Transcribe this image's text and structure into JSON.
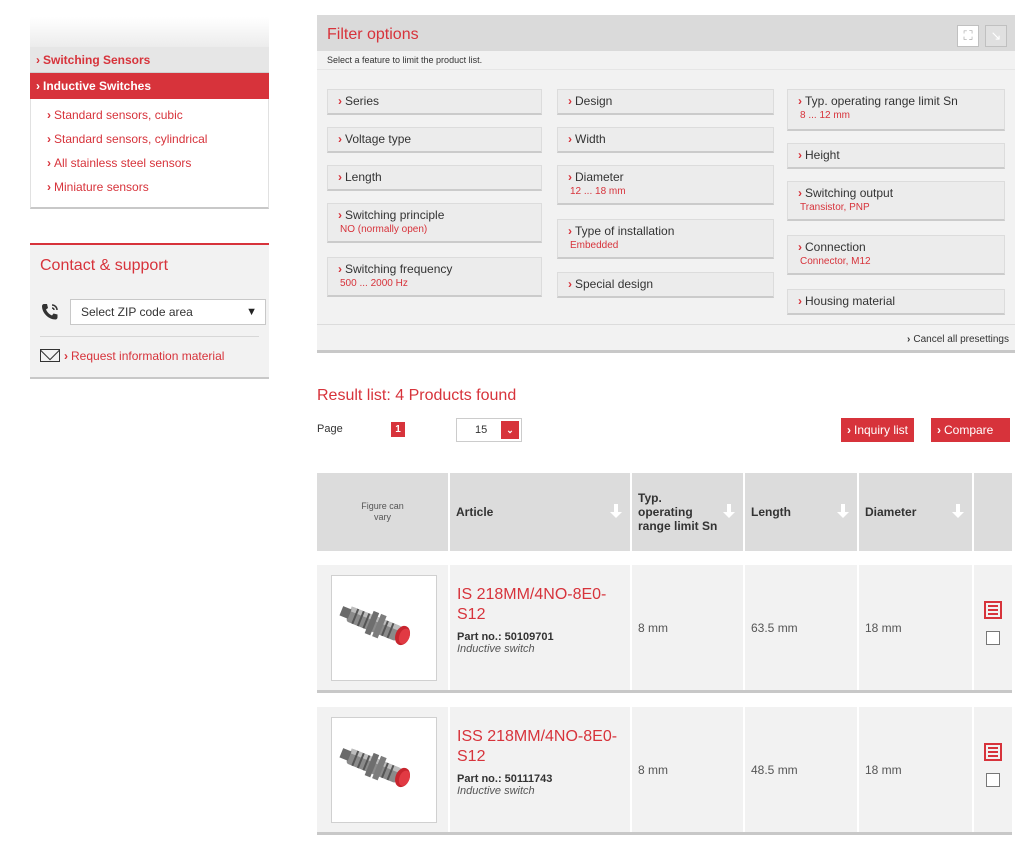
{
  "sidebar": {
    "category_parent": "Switching Sensors",
    "category_active": "Inductive Switches",
    "items": [
      {
        "label": "Standard sensors, cubic"
      },
      {
        "label": "Standard sensors, cylindrical"
      },
      {
        "label": "All stainless steel sensors"
      },
      {
        "label": "Miniature sensors"
      }
    ]
  },
  "contact": {
    "title": "Contact & support",
    "zip_select": "Select ZIP code area",
    "request_link": "Request information material"
  },
  "filter": {
    "title": "Filter options",
    "subtitle": "Select a feature to limit the product list.",
    "cancel": "Cancel all presettings",
    "buttons": {
      "series": {
        "label": "Series",
        "value": ""
      },
      "voltage": {
        "label": "Voltage type",
        "value": ""
      },
      "length": {
        "label": "Length",
        "value": ""
      },
      "principle": {
        "label": "Switching principle",
        "value": "NO (normally open)"
      },
      "frequency": {
        "label": "Switching frequency",
        "value": "500 ... 2000 Hz"
      },
      "design": {
        "label": "Design",
        "value": ""
      },
      "width": {
        "label": "Width",
        "value": ""
      },
      "diameter": {
        "label": "Diameter",
        "value": "12 ... 18 mm"
      },
      "installation": {
        "label": "Type of installation",
        "value": "Embedded"
      },
      "special": {
        "label": "Special design",
        "value": ""
      },
      "range": {
        "label": "Typ. operating range limit Sn",
        "value": "8 ... 12 mm"
      },
      "height": {
        "label": "Height",
        "value": ""
      },
      "output": {
        "label": "Switching output",
        "value": "Transistor, PNP"
      },
      "connection": {
        "label": "Connection",
        "value": "Connector, M12"
      },
      "housing": {
        "label": "Housing material",
        "value": ""
      }
    }
  },
  "results": {
    "title": "Result list: 4 Products found",
    "page_label": "Page",
    "page_current": "1",
    "per_page": "15",
    "inquiry_button": "Inquiry list",
    "compare_button": "Compare",
    "columns": {
      "figure": "Figure can vary",
      "article": "Article",
      "range": "Typ. operating range limit Sn",
      "length": "Length",
      "diameter": "Diameter"
    },
    "rows": [
      {
        "name": "IS 218MM/4NO-8E0-S12",
        "part_no": "Part no.: 50109701",
        "desc": "Inductive switch",
        "range": "8 mm",
        "length": "63.5 mm",
        "diameter": "18 mm"
      },
      {
        "name": "ISS 218MM/4NO-8E0-S12",
        "part_no": "Part no.: 50111743",
        "desc": "Inductive switch",
        "range": "8 mm",
        "length": "48.5 mm",
        "diameter": "18 mm"
      }
    ]
  },
  "colors": {
    "accent": "#d7333b",
    "panel": "#f2f2f2",
    "header": "#dcdcdc"
  }
}
